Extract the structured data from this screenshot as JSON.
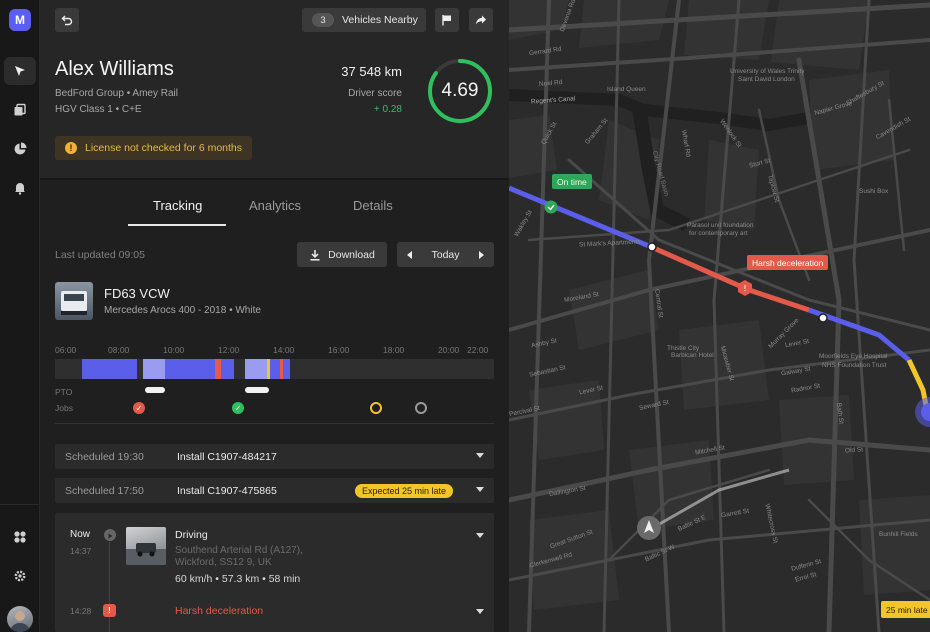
{
  "app": {
    "logo_letter": "M"
  },
  "rail": {
    "items": [
      "navigate-icon",
      "documents-icon",
      "reports-pie-icon",
      "notifications-bell-icon"
    ],
    "bottom_items": [
      "apps-grid-icon",
      "settings-gear-icon"
    ]
  },
  "header": {
    "vehicles_nearby_count": "3",
    "vehicles_nearby_label": "Vehicles Nearby"
  },
  "driver": {
    "name": "Alex Williams",
    "org": "BedFord Group  •  Amey Rail",
    "license_class": "HGV Class 1  •  C+E",
    "distance": "37 548 km",
    "score_label": "Driver score",
    "score_delta": "+ 0.28",
    "score": "4.69",
    "score_fraction": 0.85,
    "warning": "License not checked for 6 months"
  },
  "tabs": {
    "tracking": "Tracking",
    "analytics": "Analytics",
    "details": "Details"
  },
  "toolbar": {
    "last_updated": "Last updated 09:05",
    "download": "Download",
    "date": "Today"
  },
  "vehicle": {
    "plate": "FD63 VCW",
    "model": "Mercedes Arocs 400 - 2018  •  White"
  },
  "timeline": {
    "hours": [
      "06:00",
      "08:00",
      "10:00",
      "12:00",
      "14:00",
      "16:00",
      "18:00",
      "20:00",
      "22:00"
    ],
    "pto_label": "PTO",
    "jobs_label": "Jobs"
  },
  "schedule": [
    {
      "time": "Scheduled 19:30",
      "job": "Install C1907-484217",
      "badge": ""
    },
    {
      "time": "Scheduled 17:50",
      "job": "Install C1907-475865",
      "badge": "Expected 25 min late"
    }
  ],
  "events": {
    "now_label": "Now",
    "now_time": "14:37",
    "driving_title": "Driving",
    "driving_addr1": "Southend Arterial Rd (A127),",
    "driving_addr2": "Wickford, SS12 9, UK",
    "driving_stats": "60 km/h  •  57.3 km  •  58 min",
    "harsh_time": "14:28",
    "harsh_title": "Harsh deceleration"
  },
  "map": {
    "callout_on_time": "On time",
    "callout_harsh": "Harsh deceleration",
    "late_chip": "25 min late",
    "labels": {
      "devonia": "Devonia Rd",
      "gerrard": "Gerrard Rd",
      "noel": "Noel Rd",
      "regents": "Regent's Canal",
      "island_queen": "Island Queen",
      "university": "University of Wales Trinity",
      "saint_david": "Saint David London",
      "napier": "Napier Grove",
      "shaftesbury": "Shaftesbury St",
      "cavendish": "Cavendish St",
      "sushi": "Sushi Box",
      "st_marks": "St Mark's Apartments",
      "parasol1": "Parasol unit foundation",
      "parasol2": "for contemporary art",
      "moreland": "Moreland St",
      "thistle1": "Thistle City",
      "thistle2": "Barbican Hotel",
      "moorfields1": "Moorfields Eye Hospital",
      "moorfields2": "NHS Foundation Trust",
      "lever": "Lever St",
      "lever2": "Lever St",
      "seward": "Seward St",
      "radnor": "Radnor St",
      "galway": "Galway St",
      "old": "Old St",
      "bath": "Bath St",
      "mitchell": "Mitchell St",
      "central": "Central St",
      "ashby": "Ashby St",
      "sebastian": "Sebastian St",
      "percival": "Percival St",
      "dallington": "Dallington St",
      "great_sutton": "Great Sutton St",
      "clerkenwell": "Clerkenwell Rd",
      "baltic": "Baltic St W",
      "baltic_e": "Baltic St E",
      "garrett": "Garrett St",
      "dufferin": "Dufferin St",
      "errol": "Errol St",
      "bunhill": "Bunhill Fields",
      "whitecross": "Whitecross St",
      "wharf": "Wharf Rd",
      "city_road_basin": "City Road Basin",
      "graham": "Graham St",
      "quick": "Quick St",
      "wakley": "Wakley St",
      "wenlock": "Wenlock St",
      "sturt": "Sturt St",
      "taplow": "Taplow St",
      "murray": "Murray Grove",
      "micawber": "Micawber St"
    }
  }
}
